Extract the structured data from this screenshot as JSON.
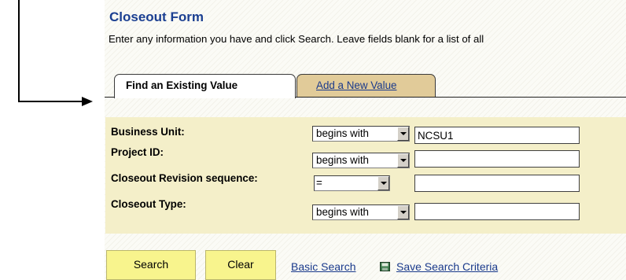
{
  "page": {
    "title": "Closeout Form",
    "instructions": "Enter any information you have and click Search. Leave fields blank for a list of all"
  },
  "tabs": [
    {
      "label": "Find an Existing Value",
      "active": true
    },
    {
      "label_first": "A",
      "label_rest": "dd a New Value",
      "active": false
    }
  ],
  "criteria": [
    {
      "label": "Business Unit:",
      "operator": "begins with",
      "value": "NCSU1"
    },
    {
      "label": "Project ID:",
      "operator": "begins with",
      "value": ""
    },
    {
      "label": "Closeout Revision sequence:",
      "operator": "=",
      "value": ""
    },
    {
      "label": "Closeout Type:",
      "operator": "begins with",
      "value": ""
    }
  ],
  "actions": {
    "search_label": "Search",
    "clear_label": "Clear",
    "basic_search_label": "Basic Search",
    "save_criteria_label": "Save Search Criteria"
  },
  "colors": {
    "title": "#1b3f91",
    "panel": "#f4efc9",
    "tab_inactive": "#e1cb99",
    "button": "#f8f48d",
    "link": "#1a3a8c"
  },
  "icons": {
    "callout": "arrow-right-icon",
    "dropdown": "chevron-down-icon",
    "save": "floppy-disk-icon"
  }
}
